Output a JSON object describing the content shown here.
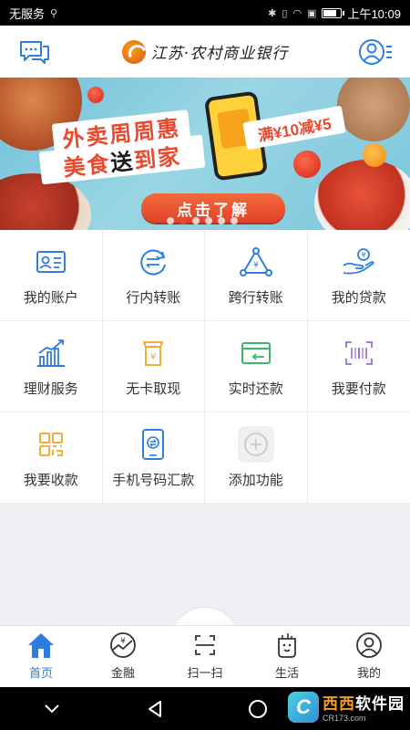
{
  "status_bar": {
    "carrier": "无服务",
    "time": "上午10:09"
  },
  "header": {
    "bank_name": "江苏·农村商业银行"
  },
  "banner": {
    "title_line1": "外卖周周惠",
    "title_line2_a": "美食",
    "title_line2_b": "送",
    "title_line2_c": "到家",
    "promo": "满¥10减¥5",
    "cta": "点击了解",
    "slide_count": 6,
    "active_slide": 2
  },
  "services": [
    {
      "label": "我的账户",
      "icon": "id-card-icon"
    },
    {
      "label": "行内转账",
      "icon": "transfer-icon"
    },
    {
      "label": "跨行转账",
      "icon": "triangle-network-icon"
    },
    {
      "label": "我的贷款",
      "icon": "loan-hand-icon"
    },
    {
      "label": "理财服务",
      "icon": "bar-chart-icon"
    },
    {
      "label": "无卡取现",
      "icon": "cardless-cash-icon"
    },
    {
      "label": "实时还款",
      "icon": "card-repay-icon"
    },
    {
      "label": "我要付款",
      "icon": "scan-pay-icon"
    },
    {
      "label": "我要收款",
      "icon": "qr-receive-icon"
    },
    {
      "label": "手机号码汇款",
      "icon": "phone-remit-icon"
    },
    {
      "label": "添加功能",
      "icon": "add-icon"
    }
  ],
  "tabs": [
    {
      "label": "首页",
      "icon": "home-icon",
      "active": true
    },
    {
      "label": "金融",
      "icon": "finance-icon",
      "active": false
    },
    {
      "label": "扫一扫",
      "icon": "scan-icon",
      "active": false
    },
    {
      "label": "生活",
      "icon": "life-cup-icon",
      "active": false
    },
    {
      "label": "我的",
      "icon": "user-icon",
      "active": false
    }
  ],
  "watermark": {
    "title_a": "西西",
    "title_b": "软件园",
    "site": "CR173.com"
  },
  "colors": {
    "accent": "#2f7de0",
    "promo_red": "#e9492f"
  }
}
